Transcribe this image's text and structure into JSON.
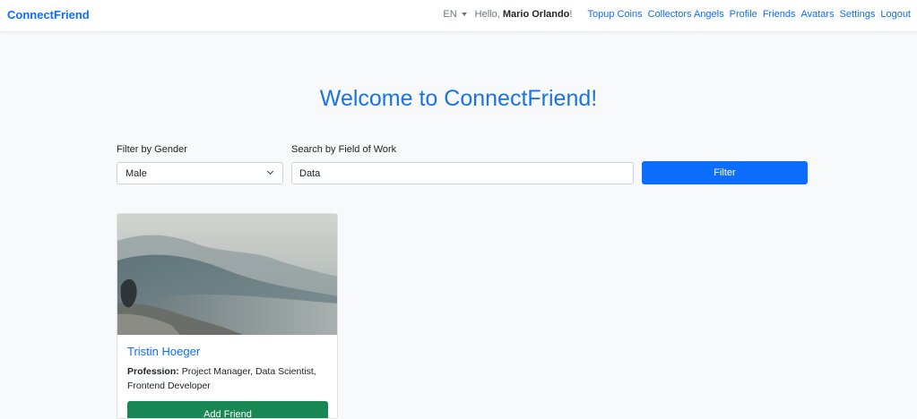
{
  "navbar": {
    "brand": "ConnectFriend",
    "language": "EN",
    "greeting_prefix": "Hello, ",
    "user_name": "Mario Orlando",
    "greeting_suffix": "!",
    "links": [
      {
        "label": "Topup Coins"
      },
      {
        "label": "Collectors Angels"
      },
      {
        "label": "Profile"
      },
      {
        "label": "Friends"
      },
      {
        "label": "Avatars"
      },
      {
        "label": "Settings"
      },
      {
        "label": "Logout"
      }
    ]
  },
  "hero": {
    "title": "Welcome to ConnectFriend!"
  },
  "filters": {
    "gender_label": "Filter by Gender",
    "gender_selected": "Male",
    "field_label": "Search by Field of Work",
    "field_value": "Data",
    "filter_button": "Filter"
  },
  "cards": [
    {
      "name": "Tristin Hoeger",
      "profession_label": "Profession:",
      "profession_value": "Project Manager, Data Scientist, Frontend Developer",
      "add_button": "Add Friend"
    }
  ],
  "colors": {
    "primary": "#0d6efd",
    "title": "#1a73e8",
    "success": "#198754",
    "background": "#f8f9fa"
  }
}
